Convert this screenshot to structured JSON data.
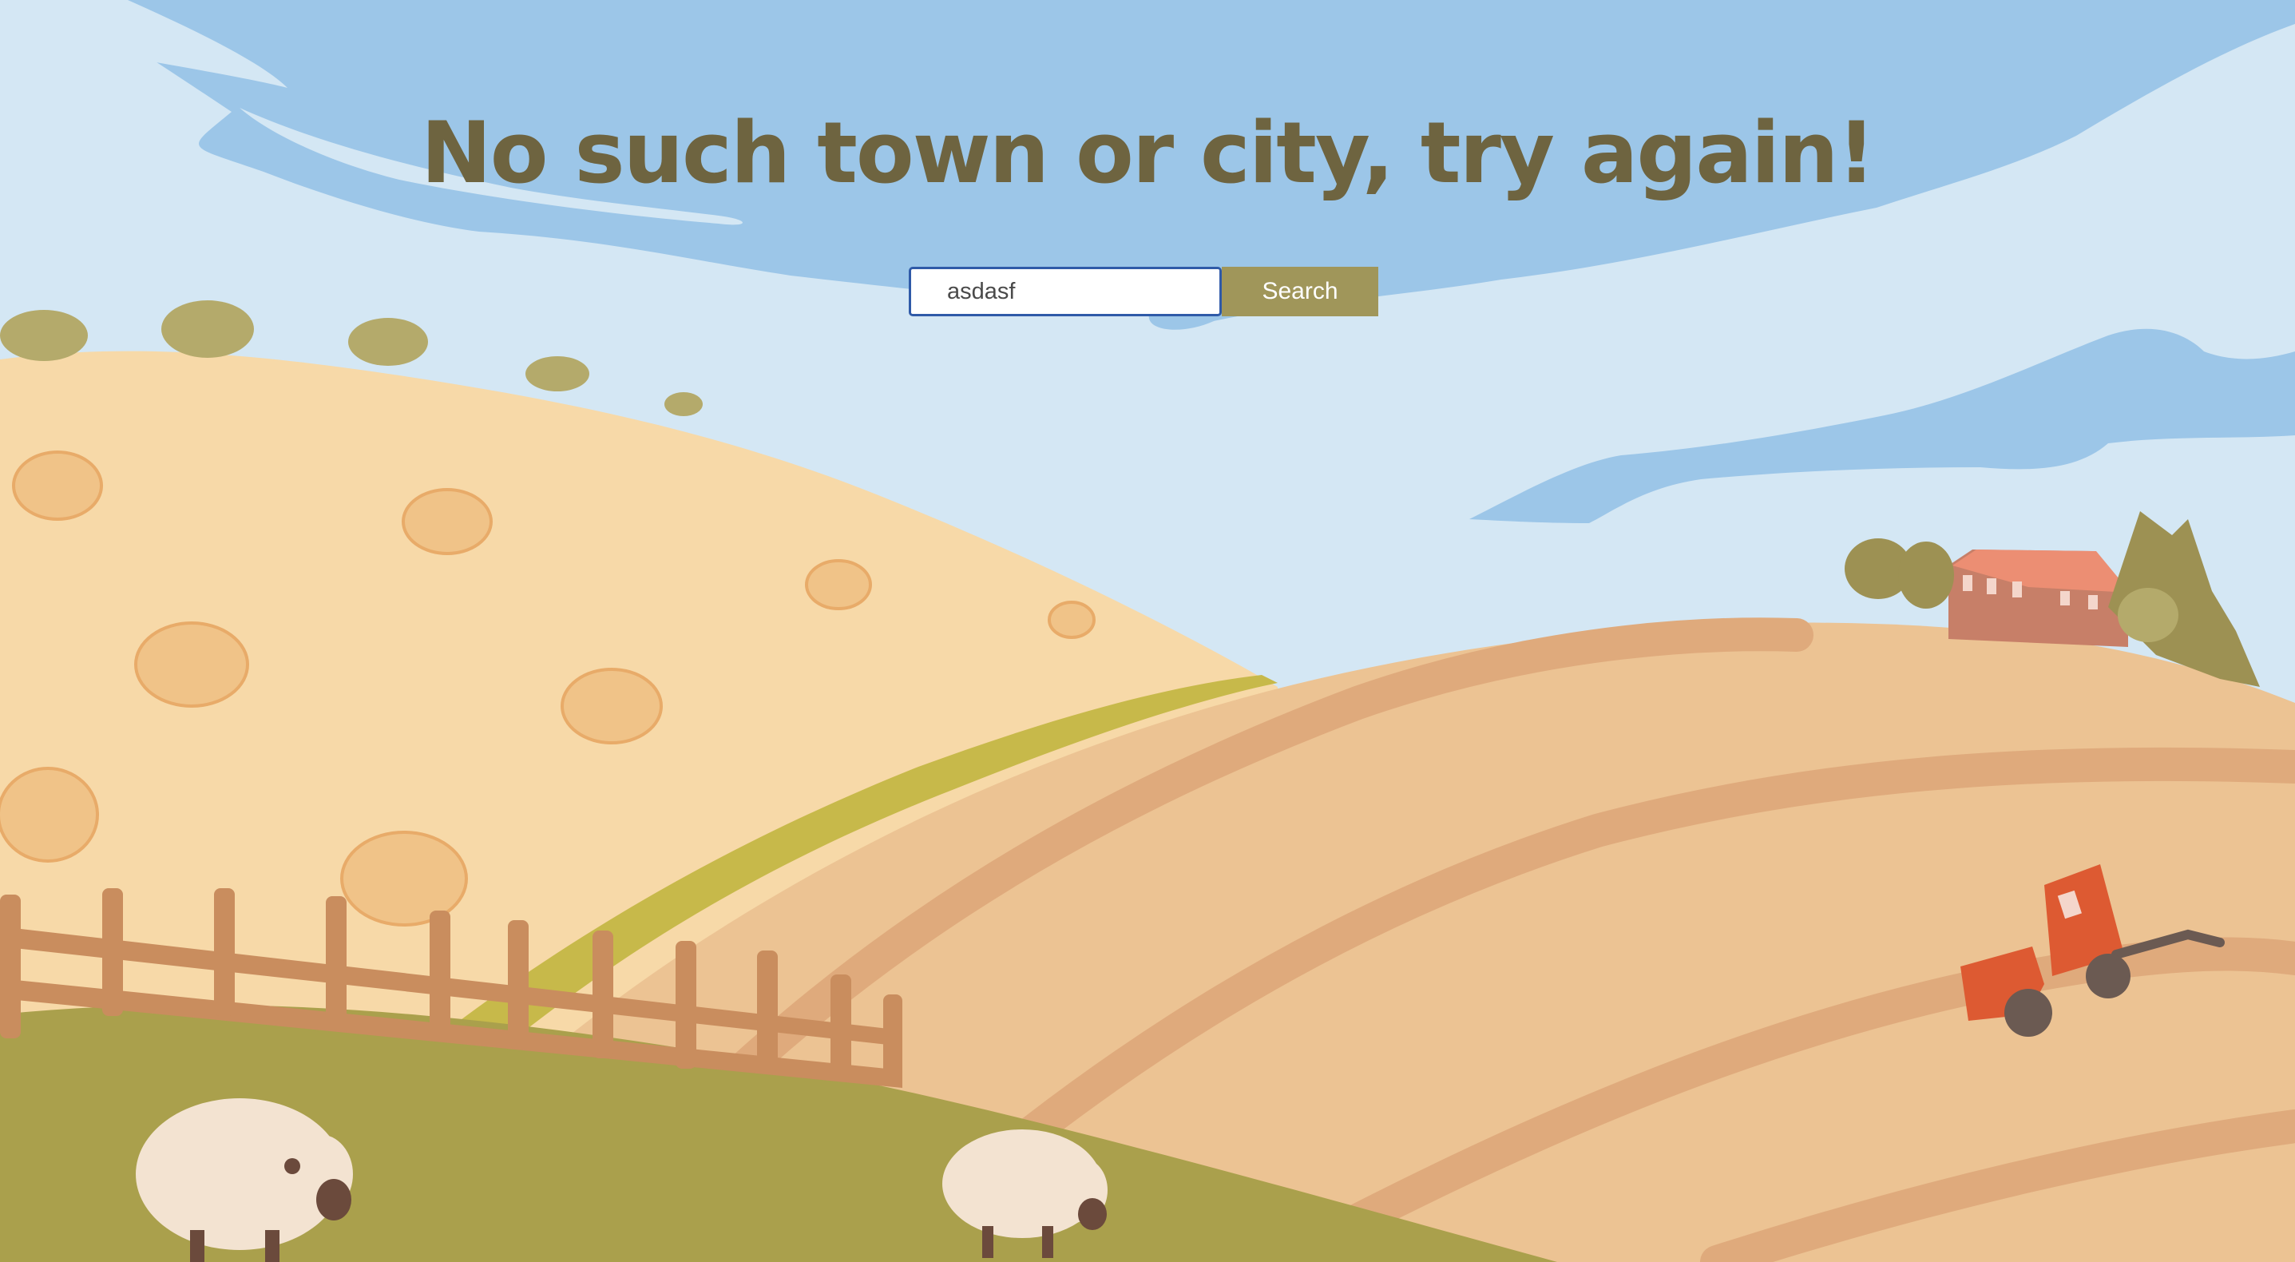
{
  "page": {
    "heading": "No such town or city, try again!"
  },
  "search": {
    "value": "asdasf",
    "button_label": "Search"
  },
  "colors": {
    "sky_light": "#d4e7f4",
    "sky_cloud_blue": "#9cc6e8",
    "heading_text": "#6e6440",
    "button_bg": "#a0965a",
    "hill_wheat": "#f7d9a8",
    "field_tan": "#ecc393",
    "field_stripe": "#dfaa7c",
    "grass_green": "#aaa04c",
    "grass_strip": "#c7b94a",
    "fence_brown": "#c98d5e",
    "tractor_red": "#dd5a32",
    "sheep_wool": "#f3e3d1",
    "house_roof": "#ec8e73",
    "tree_olive": "#9d9153"
  }
}
